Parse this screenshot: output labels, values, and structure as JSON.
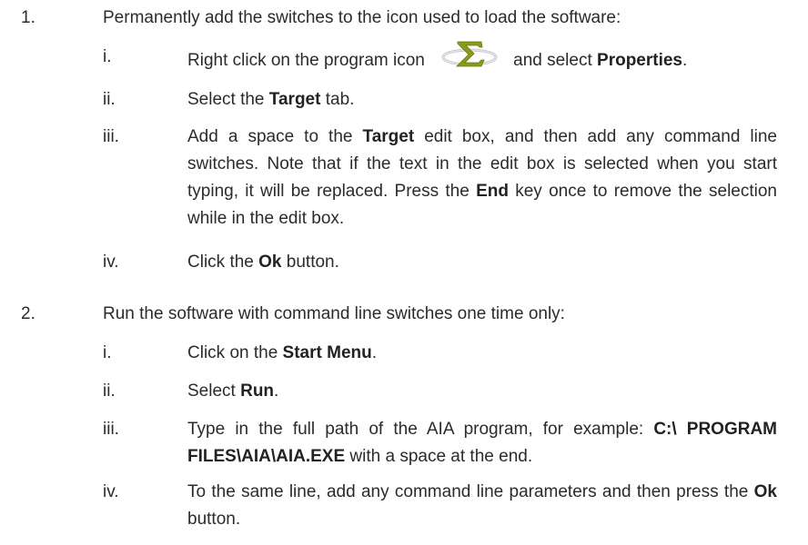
{
  "steps": [
    {
      "number": "1.",
      "title": "Permanently add the switches to the icon used to load the software:",
      "substeps": [
        {
          "numeral": "i.",
          "parts": {
            "a": "Right click on the program icon",
            "b": " and select ",
            "c": "Properties",
            "d": "."
          },
          "icon": "sigma-program-icon"
        },
        {
          "numeral": "ii.",
          "parts": {
            "a": "Select the ",
            "b": "Target",
            "c": " tab."
          }
        },
        {
          "numeral": "iii.",
          "parts": {
            "a": "Add a space to the ",
            "b": "Target",
            "c": " edit box, and then add any command line switches. Note that if the text in the edit box is selected when you start typing, it will be replaced. Press the ",
            "d": "End",
            "e": " key once to remove the selection while in the edit box."
          }
        },
        {
          "numeral": "iv.",
          "parts": {
            "a": "Click the ",
            "b": "Ok",
            "c": " button."
          }
        }
      ]
    },
    {
      "number": "2.",
      "title": "Run the software with command line switches one time only:",
      "substeps": [
        {
          "numeral": "i.",
          "parts": {
            "a": "Click on the ",
            "b": "Start Menu",
            "c": "."
          }
        },
        {
          "numeral": "ii.",
          "parts": {
            "a": "Select ",
            "b": "Run",
            "c": "."
          }
        },
        {
          "numeral": "iii.",
          "parts": {
            "a": "Type in the full path of the AIA program, for example: ",
            "b": "C:\\ PROGRAM FILES\\AIA\\AIA.EXE",
            "c": " with a space at the end."
          }
        },
        {
          "numeral": "iv.",
          "parts": {
            "a": "To the same line, add any command line parameters and then press the ",
            "b": "Ok",
            "c": " button."
          }
        }
      ]
    }
  ]
}
